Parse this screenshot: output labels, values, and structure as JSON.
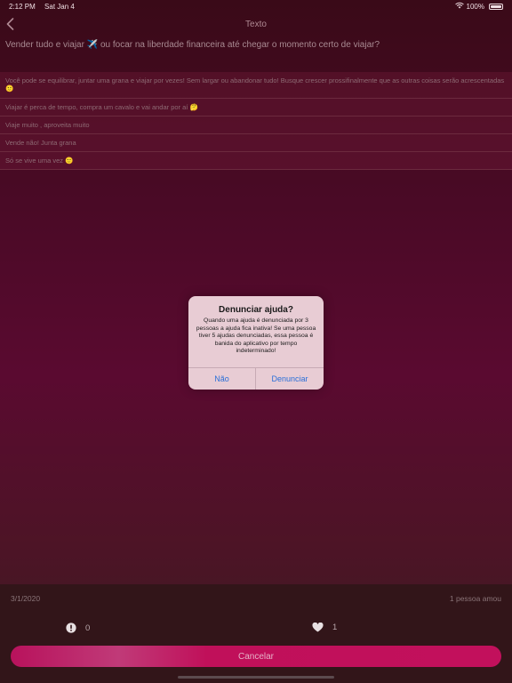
{
  "status": {
    "time": "2:12 PM",
    "date": "Sat Jan 4",
    "battery": "100%"
  },
  "nav": {
    "title": "Texto"
  },
  "question": "Vender tudo e viajar ✈️ ou focar na liberdade financeira até chegar o momento certo de viajar?",
  "answers": [
    "Você pode se equilibrar, juntar uma grana e viajar por vezes! Sem largar ou abandonar tudo! Busque crescer prossifinalmente que as outras coisas serão acrescentadas 🙂",
    "Viajar é perca de tempo, compra um cavalo e vai andar por aí 🤔",
    "Viaje muito , aproveita muito",
    "Vende não! Junta grana",
    "Só se vive uma vez 🙂"
  ],
  "footer": {
    "date": "3/1/2020",
    "likes_text": "1 pessoa amou",
    "report_count": "0",
    "like_count": "1",
    "cancel_label": "Cancelar"
  },
  "dialog": {
    "title": "Denunciar ajuda?",
    "message": "Quando uma ajuda é denunciada por 3 pessoas a ajuda fica inativa! Se uma pessoa tiver 5 ajudas denunciadas, essa pessoa é banida do aplicativo por tempo indeterminado!",
    "no_label": "Não",
    "report_label": "Denunciar"
  },
  "colors": {
    "accent": "#c2105c",
    "link_blue": "#2a6fd8"
  }
}
